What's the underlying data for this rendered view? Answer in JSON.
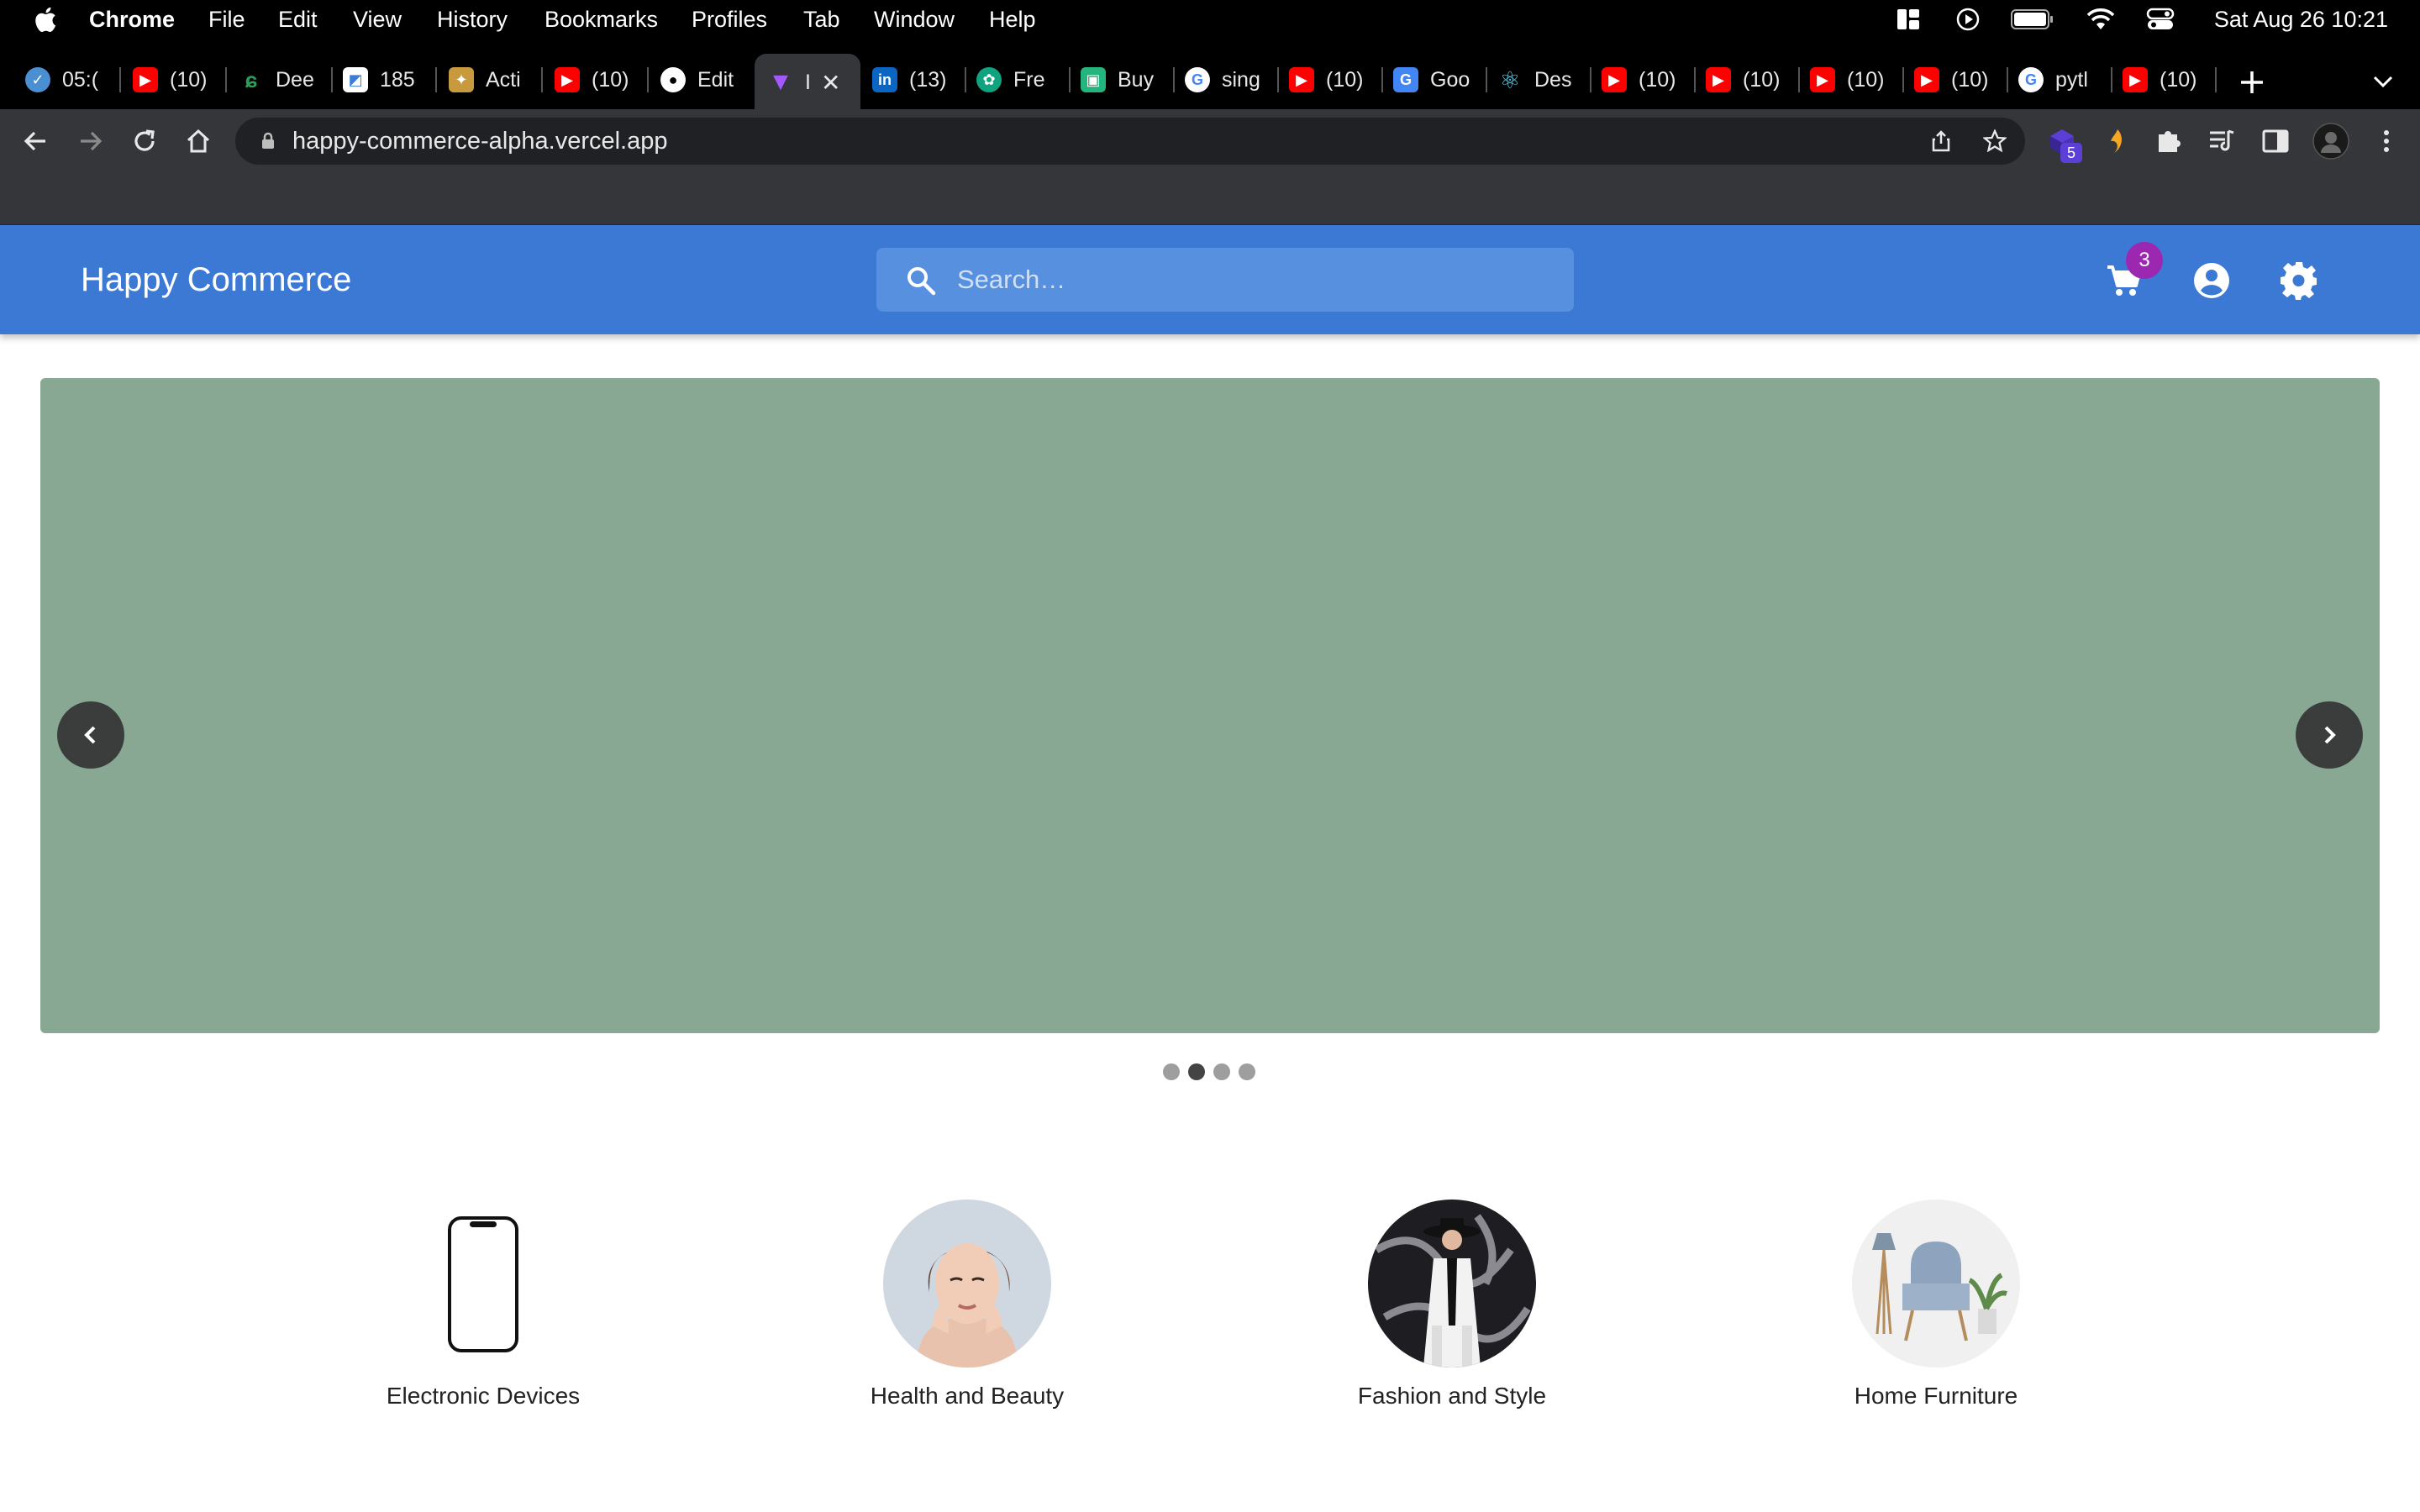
{
  "menubar": {
    "app_name": "Chrome",
    "items": [
      "File",
      "Edit",
      "View",
      "History",
      "Bookmarks",
      "Profiles",
      "Tab",
      "Window",
      "Help"
    ],
    "clock": "Sat Aug 26  10:21"
  },
  "tabs": [
    {
      "label": "05:(",
      "icon": "check-circle-icon",
      "color": "#4a8fd1"
    },
    {
      "label": "(10)",
      "icon": "youtube-icon",
      "color": "#ff0000"
    },
    {
      "label": "Dee",
      "icon": "leaf-icon",
      "color": "#2e9d5a"
    },
    {
      "label": "185",
      "icon": "document-icon",
      "color": "#3c7dd9"
    },
    {
      "label": "Acti",
      "icon": "puzzle-icon",
      "color": "#c89a3e"
    },
    {
      "label": "(10)",
      "icon": "youtube-icon",
      "color": "#ff0000"
    },
    {
      "label": "Edit",
      "icon": "github-icon",
      "color": "#ffffff"
    },
    {
      "label": "I",
      "icon": "vite-icon",
      "color": "#a259ff"
    },
    {
      "label": "(13)",
      "icon": "linkedin-icon",
      "color": "#0a66c2"
    },
    {
      "label": "Fre",
      "icon": "openai-icon",
      "color": "#10a37f"
    },
    {
      "label": "Buy",
      "icon": "shop-icon",
      "color": "#24b47e"
    },
    {
      "label": "sing",
      "icon": "google-icon",
      "color": "#ffffff"
    },
    {
      "label": "(10)",
      "icon": "youtube-icon",
      "color": "#ff0000"
    },
    {
      "label": "Goo",
      "icon": "translate-icon",
      "color": "#4285f4"
    },
    {
      "label": "Des",
      "icon": "react-icon",
      "color": "#61dafb"
    },
    {
      "label": "(10)",
      "icon": "youtube-icon",
      "color": "#ff0000"
    },
    {
      "label": "(10)",
      "icon": "youtube-icon",
      "color": "#ff0000"
    },
    {
      "label": "(10)",
      "icon": "youtube-icon",
      "color": "#ff0000"
    },
    {
      "label": "(10)",
      "icon": "youtube-icon",
      "color": "#ff0000"
    },
    {
      "label": "pytl",
      "icon": "google-icon",
      "color": "#ffffff"
    },
    {
      "label": "(10)",
      "icon": "youtube-icon",
      "color": "#ff0000"
    }
  ],
  "omnibox": {
    "url": "happy-commerce-alpha.vercel.app"
  },
  "extensions": {
    "badge_count": "5"
  },
  "header": {
    "brand": "Happy Commerce",
    "search_placeholder": "Search…",
    "cart_count": "3",
    "brand_color": "#3b79d4"
  },
  "carousel": {
    "background": "#88a893",
    "slides": 4,
    "active_slide": 2
  },
  "categories": [
    {
      "label": "Electronic Devices"
    },
    {
      "label": "Health and Beauty"
    },
    {
      "label": "Fashion and Style"
    },
    {
      "label": "Home Furniture"
    }
  ]
}
